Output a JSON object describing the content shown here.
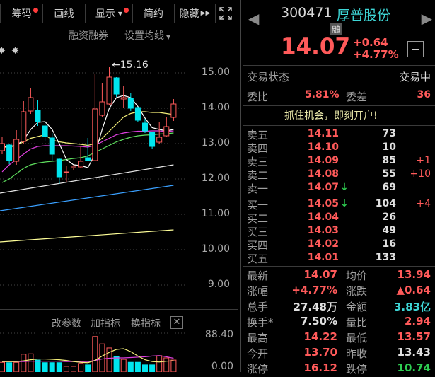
{
  "toolbar": {
    "chips": "筹码",
    "draw": "画线",
    "display": "显示",
    "simple": "简约",
    "hide": "隐藏"
  },
  "chart_menu": {
    "margin": "融资融券",
    "ma_setting": "设置均线"
  },
  "price_axis": [
    "15.00",
    "14.00",
    "13.00",
    "12.00",
    "11.00",
    "10.00",
    "9.00"
  ],
  "high_marker": "15.16",
  "volume_menu": {
    "params": "改参数",
    "add": "加指标",
    "switch": "换指标"
  },
  "volume_axis": [
    "88.40",
    "0.00"
  ],
  "colors": {
    "up": "#ff5a5a",
    "down": "#00e5ee",
    "ma5": "#ffffff",
    "ma10": "#f5f07a",
    "ma20": "#e040e0",
    "ma30": "#5fe05f",
    "ma60": "#e8e8e8",
    "ma120": "#3aa0ff",
    "ma250": "#ffff99"
  },
  "kline": {
    "price_range": [
      8.6,
      15.9
    ],
    "candles": [
      [
        12.8,
        13.0,
        13.18,
        12.7
      ],
      [
        12.96,
        12.52,
        13.0,
        12.42
      ],
      [
        12.5,
        13.12,
        13.38,
        12.4
      ],
      [
        13.06,
        13.9,
        14.2,
        13.0
      ],
      [
        13.92,
        14.3,
        14.56,
        13.84
      ],
      [
        13.94,
        13.62,
        14.24,
        13.5
      ],
      [
        13.5,
        13.2,
        13.62,
        13.06
      ],
      [
        13.16,
        12.7,
        13.3,
        12.52
      ],
      [
        12.56,
        12.06,
        12.6,
        11.86
      ],
      [
        12.2,
        12.2,
        12.36,
        11.92
      ],
      [
        12.32,
        12.36,
        12.4,
        12.26
      ],
      [
        12.34,
        12.5,
        12.92,
        12.3
      ],
      [
        12.6,
        12.52,
        13.16,
        12.5
      ],
      [
        12.52,
        13.98,
        14.98,
        12.5
      ],
      [
        13.8,
        14.18,
        14.7,
        13.76
      ],
      [
        14.12,
        14.88,
        15.16,
        14.1
      ],
      [
        14.86,
        14.4,
        14.88,
        14.32
      ],
      [
        14.26,
        14.3,
        14.62,
        14.02
      ],
      [
        14.28,
        14.0,
        14.42,
        13.92
      ],
      [
        14.02,
        13.66,
        14.04,
        13.6
      ],
      [
        13.58,
        13.36,
        13.7,
        13.3
      ],
      [
        13.32,
        12.92,
        13.34,
        12.86
      ],
      [
        13.04,
        13.18,
        13.62,
        13.0
      ],
      [
        13.22,
        13.48,
        13.76,
        13.2
      ],
      [
        13.74,
        14.12,
        14.26,
        13.64
      ]
    ],
    "ma5": [
      12.92,
      12.92,
      12.95,
      13.1,
      13.4,
      13.6,
      13.62,
      13.4,
      13.0,
      12.55,
      12.4,
      12.38,
      12.32,
      12.7,
      13.4,
      14.0,
      14.3,
      14.36,
      14.3,
      14.05,
      13.72,
      13.45,
      13.4,
      13.36,
      13.4
    ],
    "ma10": [
      12.9,
      12.9,
      12.95,
      13.05,
      13.15,
      13.2,
      13.25,
      13.1,
      13.05,
      13.02,
      13.0,
      12.98,
      12.95,
      13.0,
      13.15,
      13.35,
      13.55,
      13.75,
      13.85,
      13.9,
      13.9,
      13.88,
      13.88,
      13.85,
      13.82
    ],
    "ma20": [
      12.2,
      12.4,
      12.55,
      12.7,
      12.85,
      12.92,
      12.94,
      12.94,
      12.94,
      12.94,
      12.93,
      12.92,
      12.9,
      12.95,
      13.05,
      13.15,
      13.25,
      13.3,
      13.33,
      13.35,
      13.35,
      13.36,
      13.36,
      13.34,
      13.36
    ],
    "ma30": [
      11.9,
      12.0,
      12.15,
      12.3,
      12.4,
      12.45,
      12.48,
      12.5,
      12.52,
      12.55,
      12.58,
      12.6,
      12.65,
      12.75,
      12.85,
      12.95,
      13.05,
      13.12,
      13.18,
      13.22,
      13.24,
      13.25,
      13.27,
      13.28,
      13.3
    ],
    "ma60": [
      11.6,
      12.4
    ],
    "ma120": [
      11.1,
      11.82
    ],
    "ma250": [
      10.22,
      10.56
    ],
    "volume": [
      13,
      12,
      13,
      35,
      36,
      19,
      12,
      12,
      12,
      2,
      2,
      10,
      6,
      83,
      63,
      52,
      29,
      21,
      13,
      13,
      6,
      6,
      31,
      25,
      19
    ],
    "vol_max": 88.4,
    "vol_ma5": [
      15,
      15,
      15,
      17,
      20,
      22,
      22,
      21,
      20,
      18,
      15,
      13,
      12,
      18,
      30,
      40,
      48,
      50,
      42,
      30,
      20,
      15,
      14,
      16,
      17
    ],
    "vol_ma10": [
      15,
      15,
      15,
      15,
      16,
      16,
      16,
      16,
      16,
      15,
      15,
      15,
      15,
      18,
      22,
      24,
      25,
      25,
      26,
      27,
      28,
      30,
      31,
      28,
      24
    ]
  },
  "quote": {
    "code": "300471",
    "name": "厚普股份",
    "badge": "融",
    "price": "14.07",
    "change": "+0.64",
    "change_pct": "+4.77%"
  },
  "status": {
    "label": "交易状态",
    "value": "交易中"
  },
  "ratio": {
    "label": "委比",
    "value": "5.81%",
    "diff_label": "委差",
    "diff": "36"
  },
  "promo": "抓住机会，即刻开户!",
  "asks": [
    {
      "label": "卖五",
      "price": "14.11",
      "vol": "73",
      "chg": ""
    },
    {
      "label": "卖四",
      "price": "14.10",
      "vol": "10",
      "chg": ""
    },
    {
      "label": "卖三",
      "price": "14.09",
      "vol": "85",
      "chg": "+1"
    },
    {
      "label": "卖二",
      "price": "14.08",
      "vol": "55",
      "chg": "+10"
    },
    {
      "label": "卖一",
      "price": "14.07",
      "vol": "69",
      "chg": "",
      "arrow": "↓"
    }
  ],
  "bids": [
    {
      "label": "买一",
      "price": "14.05",
      "vol": "104",
      "chg": "+4",
      "arrow": "↓"
    },
    {
      "label": "买二",
      "price": "14.04",
      "vol": "26",
      "chg": ""
    },
    {
      "label": "买三",
      "price": "14.03",
      "vol": "49",
      "chg": ""
    },
    {
      "label": "买四",
      "price": "14.02",
      "vol": "16",
      "chg": ""
    },
    {
      "label": "买五",
      "price": "14.01",
      "vol": "133",
      "chg": ""
    }
  ],
  "stats": [
    {
      "l1": "最新",
      "v1": "14.07",
      "c1": "red",
      "l2": "均价",
      "v2": "13.94",
      "c2": "red"
    },
    {
      "l1": "涨幅",
      "v1": "+4.77%",
      "c1": "red",
      "l2": "涨跌",
      "v2": "▲0.64",
      "c2": "red"
    },
    {
      "l1": "总手",
      "v1": "27.48万",
      "c1": "wht",
      "l2": "金额",
      "v2": "3.83亿",
      "c2": "cyan"
    },
    {
      "l1": "换手*",
      "v1": "7.50%",
      "c1": "wht",
      "l2": "量比",
      "v2": "2.94",
      "c2": "red"
    },
    {
      "l1": "最高",
      "v1": "14.22",
      "c1": "red",
      "l2": "最低",
      "v2": "13.57",
      "c2": "red"
    },
    {
      "l1": "今开",
      "v1": "13.70",
      "c1": "red",
      "l2": "昨收",
      "v2": "13.43",
      "c2": "wht"
    },
    {
      "l1": "涨停",
      "v1": "16.12",
      "c1": "red",
      "l2": "跌停",
      "v2": "10.74",
      "c2": "green"
    }
  ]
}
